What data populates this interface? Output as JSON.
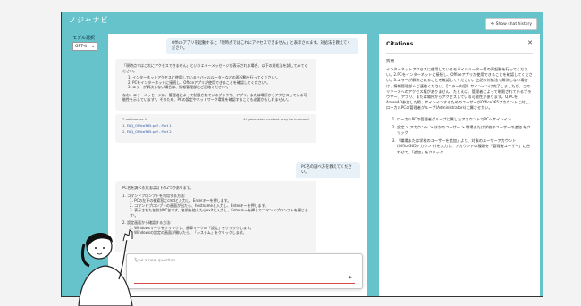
{
  "app": {
    "title": "ノジャナビ",
    "history_button": "Show chat history"
  },
  "sidebar": {
    "model_label": "モデル選択",
    "model_value": "GPT-4"
  },
  "chat": {
    "user_msg_1": "Officeアプリを起動すると「現時点ではこれにアクセスできません」と表示されます。対処法を教えてください。",
    "bot_msg_1_intro": "「現時点ではこれにアクセスできません」というエラーメッセージが表示される場合、以下の対処法を試してみてください。",
    "bot_msg_1_items": [
      "1. インターネットアクセスに使用しているモバイルルーターなどの再起動を行ってください¹。",
      "2. PCをインターネットに接続し、Officeアプリが使用できることを確認してください²。",
      "3. エラーが解決しない場合は、情報管理部にご連絡ください³。"
    ],
    "bot_msg_1_note": "なお、エラーメッセージは、管理者によって制限されているブラウザ、アプリ、または場所からアクセスしている可能性を示しています¹。そのため、PCの設定やネットワーク環境を確認することも必要かもしれません¹。",
    "refs_label": "2 references ∨",
    "refs_ai_note": "AI-generated content may be incorrect",
    "refs": [
      "1. FAQ_Office365.pdf - Part 1",
      "2. FAQ_Office365.pdf - Part 2"
    ],
    "user_msg_2": "PC名の調べ方を教えてください。",
    "bot_msg_2_intro": "PC名を調べる方法は以下の2つがあります。",
    "bot_msg_2_h1": "1. コマンドプロンプトを利用する方法:",
    "bot_msg_2_h1_items": [
      "1. PCの左下の検索窓にcmdと入力し、Enterキーを押します。",
      "2. コマンドプロンプトの画面が出たら、hostnameと入力し、Enterキーを押します。",
      "3. 表示された名前がPC名です。名前を控えたらexitと入力し、Enterキーを押してコマンドプロンプトを閉じます¹。"
    ],
    "bot_msg_2_h2": "2. 設定画面から確認する方法:",
    "bot_msg_2_h2_items": [
      "1. Windowsマークをクリックし、歯車マークの「設定」をクリックします。",
      "2. Windowsの設定の画面が開いたら、「システム」をクリックします。"
    ],
    "input_placeholder": "Type a new question..."
  },
  "citations": {
    "title": "Citations",
    "question_label": "質問",
    "body": "インターネットアクセスに使用しているモバイルルーター等の再起動を行ってください。2.PCをインターネットに接続し、Officeアプリが使用できることを確認してください。3.エラーが解決されることを確認してください。上記の対処法で解決しない場合は、情報管理部へご連絡ください。【エラー内容】サインインは完了しましたが、このリソースへのアクセス権がありません。たとえば、管理者によって制限されているブラウザー、アプリ、または場所からアクセスしている可能性があります。Q.PCをAzureAD参加した際、サインインするためのユーザーがOffice365アカウントに対し、ローカルPCの管理者グループ(Administrators)に属させたい。",
    "steps": [
      "ローカルPCの管理者グループに属したアカウントでPCへサインイン",
      "設定 > アカウント > ほかのユーザー > 職場または学校のユーザーの追加 をクリック",
      "「職場または学校のユーザーを追加」より、対象のユーザーアカウント(Office365アカウント)を入力し、アカウントの種類を「管理者ユーザー」に合わせて、「追加」をクリック"
    ]
  }
}
